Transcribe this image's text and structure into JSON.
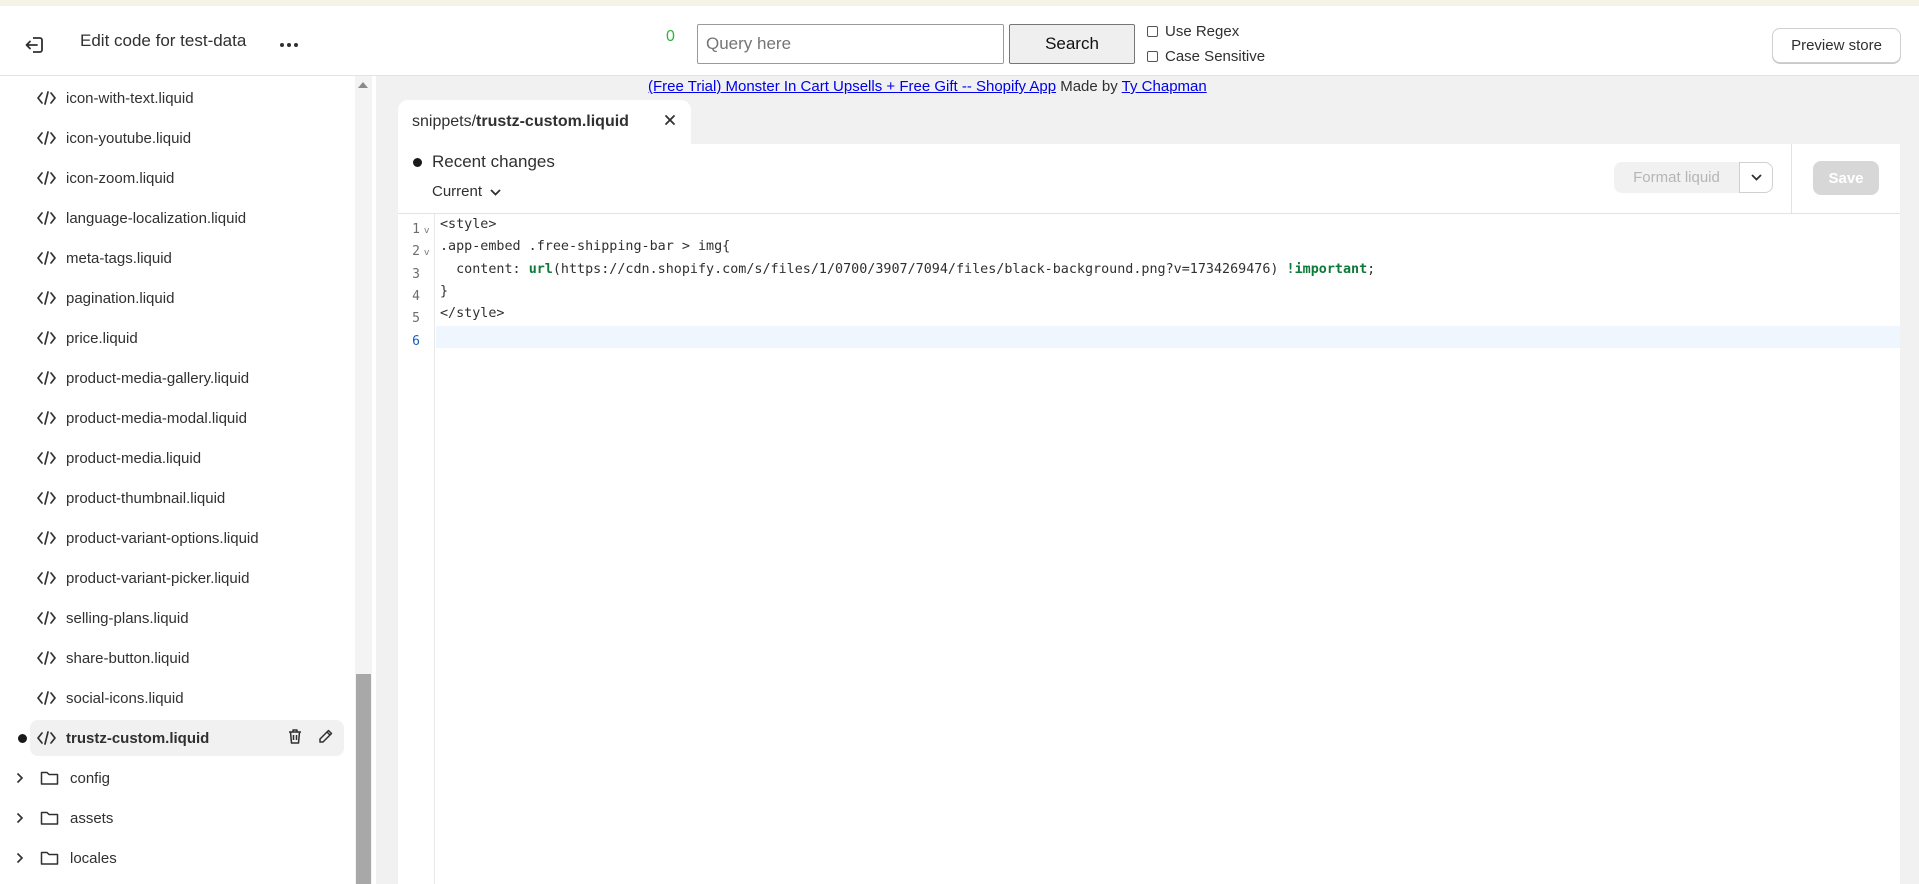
{
  "header": {
    "title": "Edit code for test-data",
    "match_count": "0",
    "query_placeholder": "Query here",
    "search_label": "Search",
    "use_regex_label": "Use Regex",
    "case_sensitive_label": "Case Sensitive",
    "preview_label": "Preview store"
  },
  "banner": {
    "link_text": "(Free Trial) Monster In Cart Upsells + Free Gift -- Shopify App",
    "made_by": "Made by",
    "author": "Ty Chapman"
  },
  "sidebar": {
    "files": [
      "icon-with-text.liquid",
      "icon-youtube.liquid",
      "icon-zoom.liquid",
      "language-localization.liquid",
      "meta-tags.liquid",
      "pagination.liquid",
      "price.liquid",
      "product-media-gallery.liquid",
      "product-media-modal.liquid",
      "product-media.liquid",
      "product-thumbnail.liquid",
      "product-variant-options.liquid",
      "product-variant-picker.liquid",
      "selling-plans.liquid",
      "share-button.liquid",
      "social-icons.liquid",
      "trustz-custom.liquid"
    ],
    "folders": [
      "config",
      "assets",
      "locales"
    ]
  },
  "tab": {
    "path_prefix": "snippets/",
    "filename": "trustz-custom.liquid"
  },
  "editor": {
    "recent_changes": "Recent changes",
    "current_label": "Current",
    "format_label": "Format liquid",
    "save_label": "Save",
    "line_numbers": [
      "1",
      "2",
      "3",
      "4",
      "5",
      "6"
    ],
    "lines": {
      "l1": "<style>",
      "l2": ".app-embed .free-shipping-bar > img{",
      "l3_indent": "  content: ",
      "l3_fn": "url",
      "l3_arg": "(https://cdn.shopify.com/s/files/1/0700/3907/7094/files/black-background.png?v=1734269476) ",
      "l3_important": "!important",
      "l3_end": ";",
      "l4": "}",
      "l5": "</style>",
      "l6": ""
    }
  },
  "colors": {
    "accent_green": "#2fb53a",
    "keyword_green": "#0d7a3a",
    "link_blue": "#0000ee"
  }
}
